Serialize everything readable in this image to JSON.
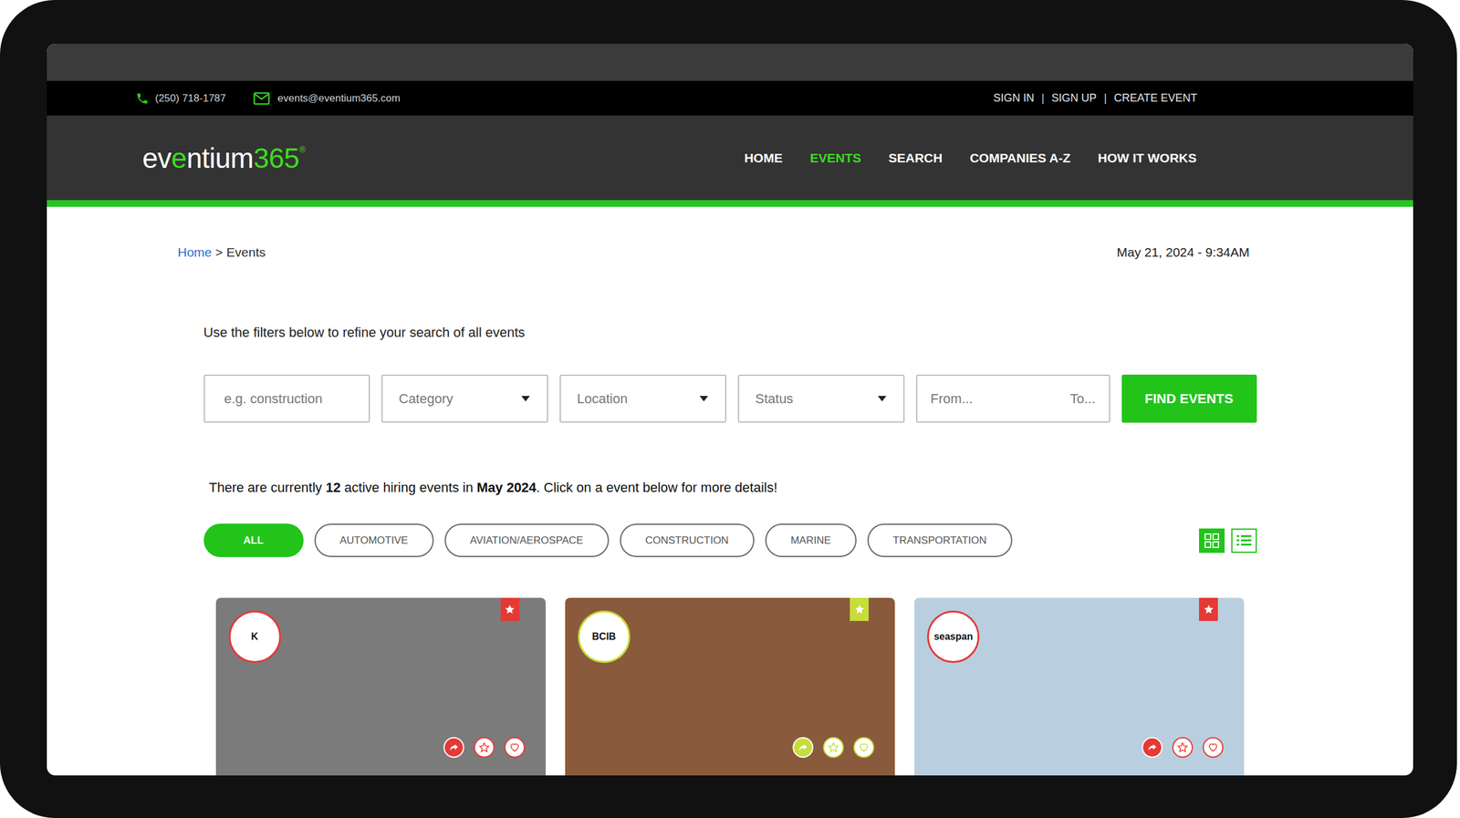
{
  "contact": {
    "phone": "(250) 718-1787",
    "email": "events@eventium365.com"
  },
  "account_links": [
    "SIGN IN",
    "SIGN UP",
    "CREATE EVENT"
  ],
  "account_separator": "|",
  "logo": [
    {
      "text": "ev",
      "color": "#ffffff"
    },
    {
      "text": "e",
      "color": "#3ddc1f"
    },
    {
      "text": "ntium",
      "color": "#ffffff"
    },
    {
      "text": "365",
      "color": "#3ddc1f"
    },
    {
      "text": "®",
      "color": "#3ddc1f"
    }
  ],
  "nav": [
    {
      "label": "HOME",
      "selected": false
    },
    {
      "label": "EVENTS",
      "selected": true
    },
    {
      "label": "SEARCH",
      "selected": false
    },
    {
      "label": "COMPANIES A-Z",
      "selected": false
    },
    {
      "label": "HOW IT WORKS",
      "selected": false
    }
  ],
  "breadcrumb": {
    "items": [
      "Home",
      "Events"
    ],
    "separator": ">"
  },
  "datetime": "May 21, 2024 - 9:34AM",
  "filters": {
    "intro": "Use the filters below to refine your search of all events",
    "keyword_placeholder": "e.g. construction",
    "dropdowns": [
      "Category",
      "Location",
      "Status"
    ],
    "from_placeholder": "From...",
    "to_placeholder": "To...",
    "button": "FIND EVENTS"
  },
  "summary": [
    {
      "text": "There are currently ",
      "bold": false
    },
    {
      "text": "12",
      "bold": true
    },
    {
      "text": " active hiring events in ",
      "bold": false
    },
    {
      "text": "May 2024",
      "bold": true
    },
    {
      "text": ". Click on a event below for more details!",
      "bold": false
    }
  ],
  "categories": [
    {
      "label": "ALL",
      "selected": true
    },
    {
      "label": "AUTOMOTIVE",
      "selected": false
    },
    {
      "label": "AVIATION/AEROSPACE",
      "selected": false
    },
    {
      "label": "CONSTRUCTION",
      "selected": false
    },
    {
      "label": "MARINE",
      "selected": false
    },
    {
      "label": "TRANSPORTATION",
      "selected": false
    }
  ],
  "views": [
    {
      "kind": "grid",
      "selected": true
    },
    {
      "kind": "list",
      "selected": false
    }
  ],
  "events": [
    {
      "logo": "K",
      "color": "#e53935"
    },
    {
      "logo": "BCIB",
      "color": "#c6dd3a"
    },
    {
      "logo": "seaspan",
      "color": "#e53935"
    }
  ]
}
